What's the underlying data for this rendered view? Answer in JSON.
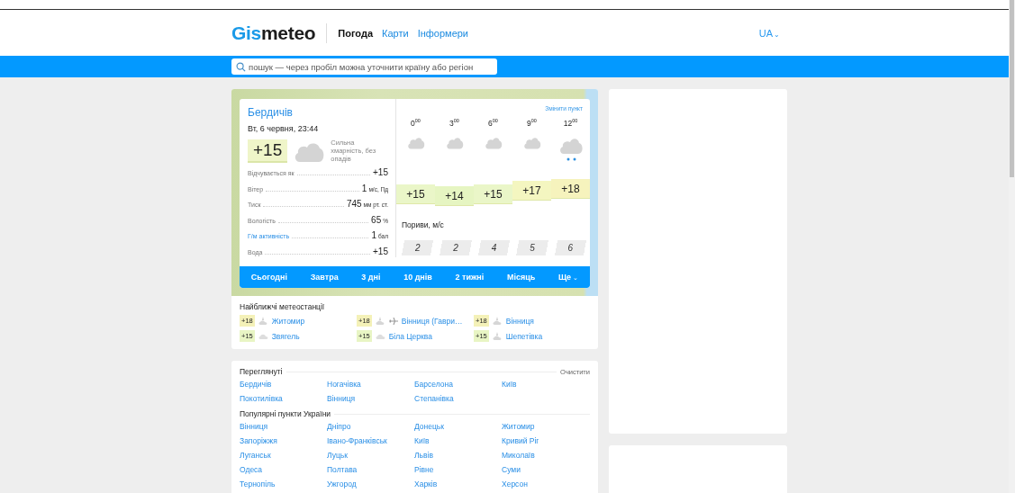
{
  "header": {
    "logo": {
      "first": "Gis",
      "second": "meteo"
    },
    "nav": [
      {
        "label": "Погода",
        "selected": true
      },
      {
        "label": "Карти",
        "selected": false
      },
      {
        "label": "Інформери",
        "selected": false
      }
    ],
    "language": {
      "label": "UA",
      "caret": "⌄"
    }
  },
  "search": {
    "placeholder": "пошук — через пробіл можна уточнити країну або регіон"
  },
  "weather": {
    "city": "Бердичів",
    "change_link": "Змінити пункт",
    "datetime": "Вт, 6 червня, 23:44",
    "current": {
      "temp": "+15",
      "description": "Сильна хмарність, без опадів"
    },
    "params": [
      {
        "label": "Відчувається як",
        "value": "+15",
        "kind": "text"
      },
      {
        "label": "Вітер",
        "value": "1",
        "unit": "м/с, Пд",
        "kind": "text"
      },
      {
        "label": "Тиск",
        "value": "745",
        "unit": "мм рт. ст.",
        "kind": "text"
      },
      {
        "label": "Вологість",
        "value": "65",
        "unit": "%",
        "kind": "text"
      },
      {
        "label": "Г/м активність",
        "value": "1",
        "unit": "бал",
        "kind": "link"
      },
      {
        "label": "Вода",
        "value": "+15",
        "kind": "text"
      }
    ],
    "hours": [
      {
        "time": "0$^{00}$",
        "kind": "cloudy",
        "temp": "+15",
        "color": "#eaf6c8"
      },
      {
        "time": "3$^{00}$",
        "kind": "cloudy",
        "temp": "+14",
        "color": "#e6f5c2"
      },
      {
        "time": "6$^{00}$",
        "kind": "cloudy",
        "temp": "+15",
        "color": "#eaf6c8"
      },
      {
        "time": "9$^{00}$",
        "kind": "cloudy",
        "temp": "+17",
        "color": "#f4f6c0"
      },
      {
        "time": "12$^{00}$",
        "kind": "rain",
        "temp": "+18",
        "color": "#f6f3bd"
      }
    ],
    "gusts_title": "Пориви, м/с",
    "gusts": [
      "2",
      "2",
      "4",
      "5",
      "6"
    ],
    "tabs": [
      {
        "label": "Сьогодні"
      },
      {
        "label": "Завтра"
      },
      {
        "label": "3 дні"
      },
      {
        "label": "10 днів"
      },
      {
        "label": "2 тижні"
      },
      {
        "label": "Місяць"
      },
      {
        "label": "Ще",
        "caret": "⌄"
      }
    ]
  },
  "stations": {
    "title": "Найближчі метеостанції",
    "items": [
      {
        "temp": "+18",
        "color": "#f4f1b8",
        "kind": "partly",
        "airport": false,
        "name": "Житомир"
      },
      {
        "temp": "+18",
        "color": "#f4f1b8",
        "kind": "partly",
        "airport": true,
        "name": "Вінниця (Гаври…"
      },
      {
        "temp": "+18",
        "color": "#f4f1b8",
        "kind": "partly",
        "airport": false,
        "name": "Вінниця"
      },
      {
        "temp": "+15",
        "color": "#e8f5c4",
        "kind": "cloudy",
        "airport": false,
        "name": "Звягель"
      },
      {
        "temp": "+15",
        "color": "#e8f5c4",
        "kind": "cloudy",
        "airport": false,
        "name": "Біла Церква"
      },
      {
        "temp": "+15",
        "color": "#e8f5c4",
        "kind": "partly",
        "airport": false,
        "name": "Шепетівка"
      }
    ]
  },
  "viewed": {
    "title": "Переглянуті",
    "clear": "Очистити",
    "items": [
      "Бердичів",
      "Ногачівка",
      "Барселона",
      "Київ",
      "Покотилівка",
      "Вінниця",
      "Степанівка"
    ]
  },
  "popular": {
    "title": "Популярні пункти України",
    "items": [
      "Вінниця",
      "Дніпро",
      "Донецьк",
      "Житомир",
      "Запоріжжя",
      "Івано-Франківськ",
      "Київ",
      "Кривий Ріг",
      "Луганськ",
      "Луцьк",
      "Львів",
      "Миколаїв",
      "Одеса",
      "Полтава",
      "Рівне",
      "Суми",
      "Тернопіль",
      "Ужгород",
      "Харків",
      "Херсон"
    ]
  }
}
